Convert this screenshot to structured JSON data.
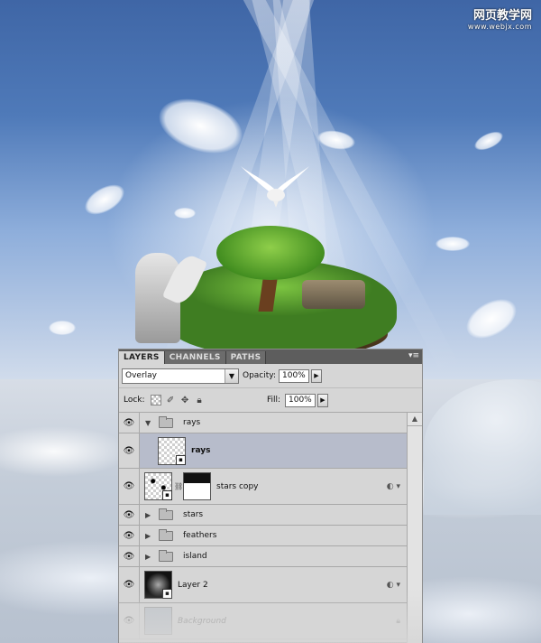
{
  "watermark": {
    "site_name": "网页教学网",
    "url": "www.webjx.com"
  },
  "colors": {
    "panel_bg": "#d6d6d6",
    "selected_row": "#b7bccb",
    "tab_bar": "#5d5d5d"
  },
  "panel": {
    "tabs": [
      {
        "label": "LAYERS",
        "active": true
      },
      {
        "label": "CHANNELS",
        "active": false
      },
      {
        "label": "PATHS",
        "active": false
      }
    ],
    "menu_icon": "panel-menu-icon",
    "blend_mode": "Overlay",
    "opacity_label": "Opacity:",
    "opacity_value": "100%",
    "lock_label": "Lock:",
    "fill_label": "Fill:",
    "fill_value": "100%",
    "layers": [
      {
        "name": "rays",
        "kind": "group",
        "expanded": true,
        "visible": true
      },
      {
        "name": "rays",
        "kind": "layer",
        "selected": true,
        "visible": true
      },
      {
        "name": "stars copy",
        "kind": "layer-with-mask",
        "visible": true,
        "fx": true
      },
      {
        "name": "stars",
        "kind": "group",
        "expanded": false,
        "visible": true
      },
      {
        "name": "feathers",
        "kind": "group",
        "expanded": false,
        "visible": true
      },
      {
        "name": "island",
        "kind": "group",
        "expanded": false,
        "visible": true
      },
      {
        "name": "Layer 2",
        "kind": "layer",
        "visible": true,
        "fx": true
      },
      {
        "name": "Background",
        "kind": "layer",
        "visible": true,
        "locked": true
      }
    ]
  }
}
